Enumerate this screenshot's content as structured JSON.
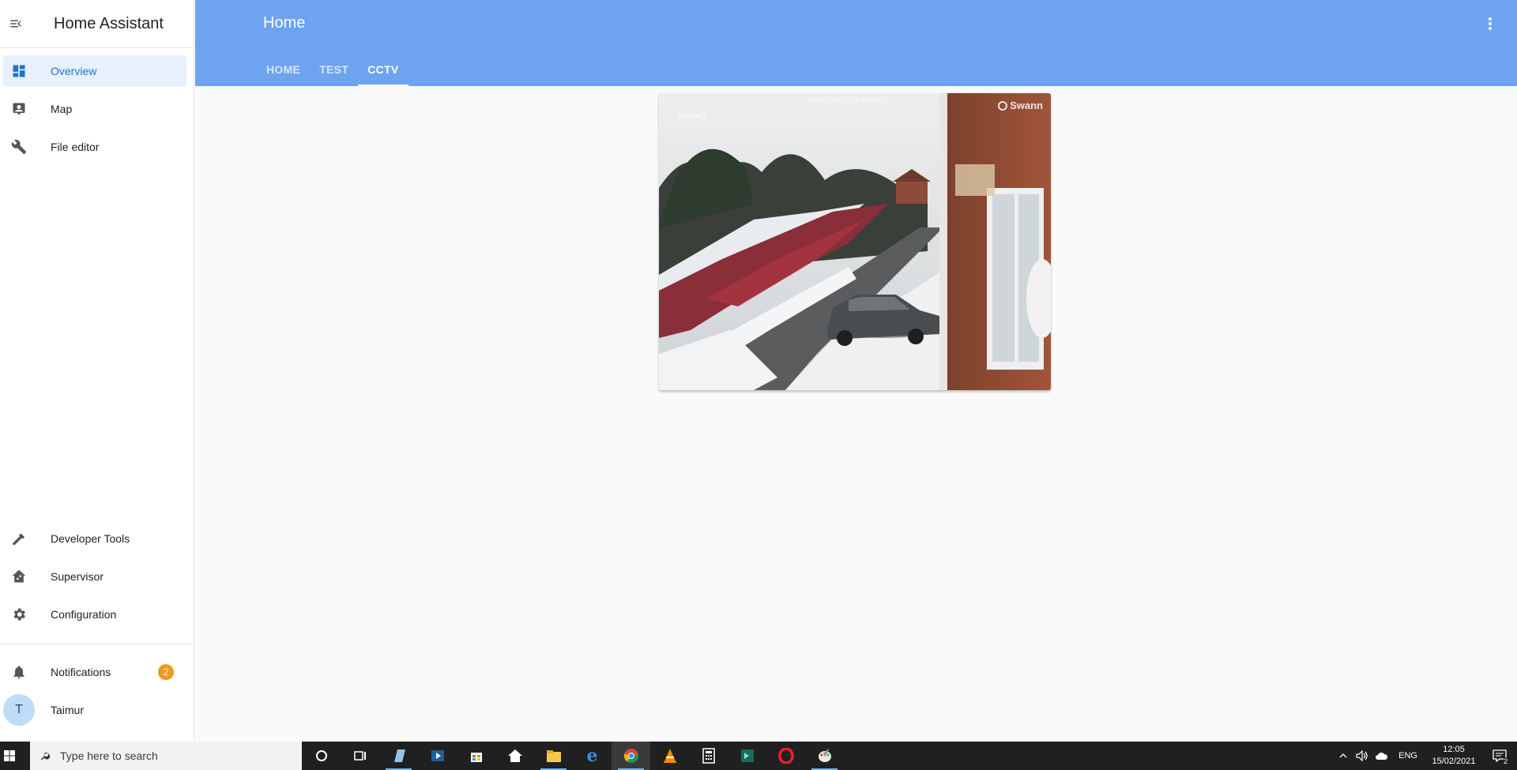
{
  "sidebar": {
    "title": "Home Assistant",
    "top_items": [
      {
        "label": "Overview",
        "icon": "view-dashboard-icon",
        "active": true
      },
      {
        "label": "Map",
        "icon": "account-box-icon"
      },
      {
        "label": "File editor",
        "icon": "wrench-icon"
      }
    ],
    "bottom_items": [
      {
        "label": "Developer Tools",
        "icon": "hammer-icon"
      },
      {
        "label": "Supervisor",
        "icon": "home-assistant-icon"
      },
      {
        "label": "Configuration",
        "icon": "cog-icon"
      }
    ],
    "notifications": {
      "label": "Notifications",
      "count": "2"
    },
    "user": {
      "initial": "T",
      "name": "Taimur"
    }
  },
  "header": {
    "title": "Home",
    "tabs": [
      {
        "label": "HOME"
      },
      {
        "label": "TEST"
      },
      {
        "label": "CCTV",
        "active": true
      }
    ]
  },
  "camera": {
    "timestamp": "15/02/2021  12:04:47",
    "channel": "Channel 1",
    "logo": "Swann"
  },
  "taskbar": {
    "search_placeholder": "Type here to search",
    "language": "ENG",
    "time": "12:05",
    "date": "15/02/2021",
    "notification_count": "2"
  },
  "colors": {
    "header": "#6ea3ef",
    "active_bg": "#e8f0fd",
    "badge": "#ee9a20",
    "avatar": "#bfdcf7"
  }
}
